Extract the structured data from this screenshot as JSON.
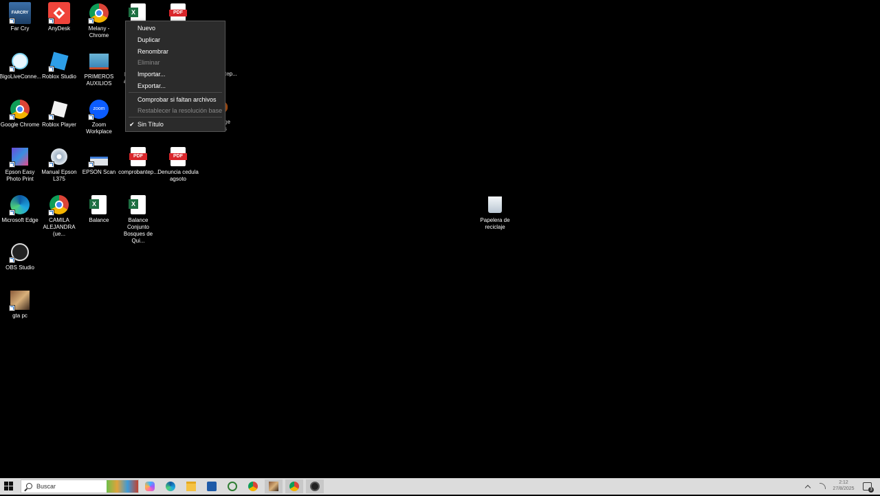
{
  "desktop": {
    "icons": [
      {
        "label": "Far Cry"
      },
      {
        "label": "AnyDesk"
      },
      {
        "label": "Melany - Chrome"
      },
      {
        "label": "BigoLiveConne..."
      },
      {
        "label": "Roblox Studio"
      },
      {
        "label": "PRIMEROS AUXILIOS"
      },
      {
        "label": "Google Chrome"
      },
      {
        "label": "Roblox Player"
      },
      {
        "label": "Zoom Workplace"
      },
      {
        "label": "Epson Easy Photo Print"
      },
      {
        "label": "Manual Epson L375"
      },
      {
        "label": "EPSON Scan"
      },
      {
        "label": "comprobantep..."
      },
      {
        "label": "Denuncia cedula agsoto"
      },
      {
        "label": "Microsoft Edge"
      },
      {
        "label": "CAMILA ALEJANDRA (ue..."
      },
      {
        "label": "Balance"
      },
      {
        "label": "Balance Conjunto Bosques de Qui..."
      },
      {
        "label": "OBS Studio"
      },
      {
        "label": "gta pc"
      },
      {
        "label": "Papelera de reciclaje"
      }
    ],
    "partial_labels": {
      "tep": "tep...",
      "ge": "ge",
      "s": "s",
      "a": "a",
      "i": "l"
    }
  },
  "context_menu": {
    "items": [
      {
        "label": "Nuevo",
        "enabled": true
      },
      {
        "label": "Duplicar",
        "enabled": true
      },
      {
        "label": "Renombrar",
        "enabled": true
      },
      {
        "label": "Eliminar",
        "enabled": false
      },
      {
        "label": "Importar...",
        "enabled": true
      },
      {
        "label": "Exportar...",
        "enabled": true
      },
      {
        "label": "Comprobar si faltan archivos",
        "enabled": true
      },
      {
        "label": "Restablecer la resolución base",
        "enabled": false
      },
      {
        "label": "Sin Título",
        "enabled": true,
        "checked": true
      }
    ],
    "check_glyph": "✔"
  },
  "taskbar": {
    "search_placeholder": "Buscar",
    "apps": [
      "copilot-icon",
      "edge-icon",
      "file-explorer-icon",
      "store-icon",
      "whatsapp-icon",
      "chrome-icon",
      "gta-icon",
      "chrome-profile-icon",
      "obs-icon"
    ],
    "clock": {
      "time": "2:12",
      "date": "27/8/2025"
    },
    "notification_count": "3"
  },
  "colors": {
    "desktop": "#000000",
    "menu_bg": "#2b2b2b",
    "taskbar": "#dcdcdc"
  }
}
